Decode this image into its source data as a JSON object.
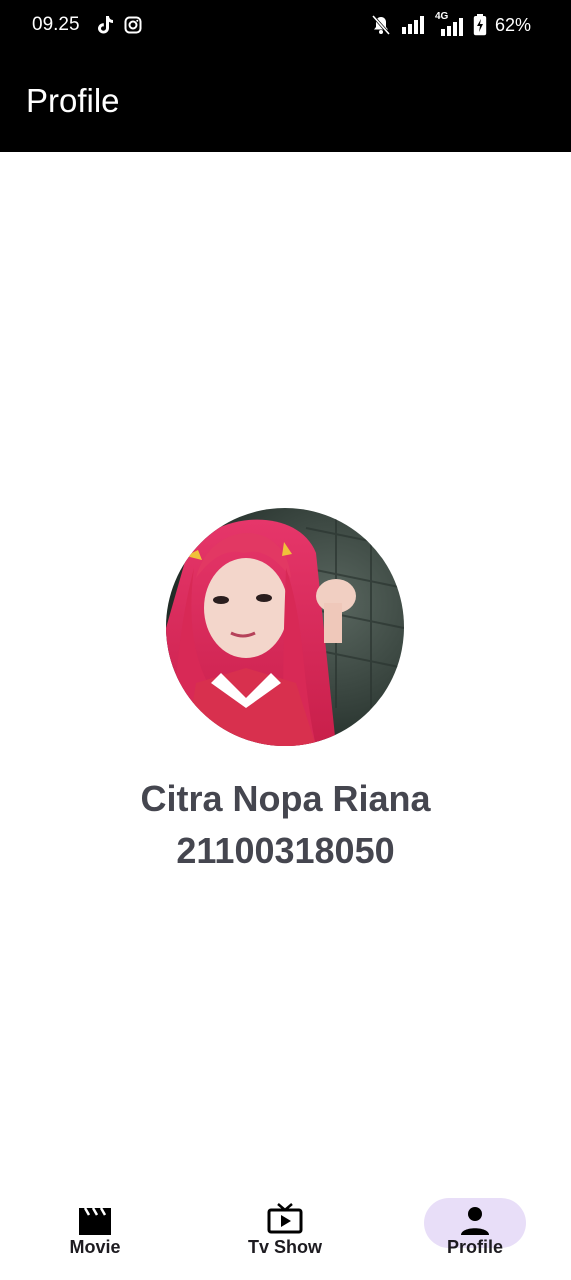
{
  "status_bar": {
    "time": "09.25",
    "battery": "62%",
    "network": "4G",
    "icons": [
      "tiktok-icon",
      "instagram-icon",
      "mute-icon",
      "signal-icon",
      "signal-4g-icon",
      "battery-icon"
    ]
  },
  "app_bar": {
    "title": "Profile"
  },
  "profile": {
    "name": "Citra Nopa Riana",
    "id_number": "21100318050",
    "avatar": "avatar-photo"
  },
  "bottom_nav": {
    "items": [
      {
        "label": "Movie",
        "icon": "movie-clapper-icon",
        "active": false
      },
      {
        "label": "Tv Show",
        "icon": "tv-icon",
        "active": false
      },
      {
        "label": "Profile",
        "icon": "person-icon",
        "active": true
      }
    ],
    "active_color": "#e8def8"
  },
  "colors": {
    "app_bar_bg": "#000000",
    "text_primary": "#45464f",
    "background": "#ffffff"
  }
}
